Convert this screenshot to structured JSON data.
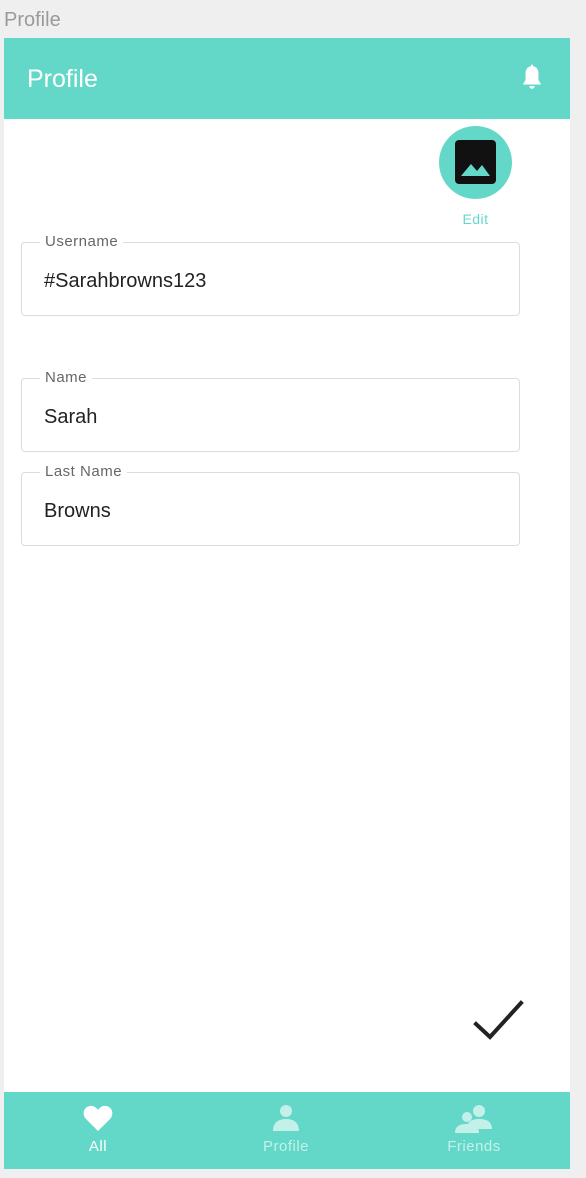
{
  "window": {
    "title": "Profile"
  },
  "app_bar": {
    "title": "Profile",
    "icon": "bell-icon"
  },
  "avatar": {
    "icon": "image-icon",
    "edit_label": "Edit"
  },
  "fields": {
    "username": {
      "label": "Username",
      "value": "#Sarahbrowns123"
    },
    "name": {
      "label": "Name",
      "value": "Sarah"
    },
    "last_name": {
      "label": "Last Name",
      "value": "Browns"
    }
  },
  "confirm": {
    "icon": "check-icon"
  },
  "bottom_nav": {
    "items": [
      {
        "label": "All",
        "icon": "heart-icon",
        "active": true
      },
      {
        "label": "Profile",
        "icon": "person-icon",
        "active": false
      },
      {
        "label": "Friends",
        "icon": "people-icon",
        "active": false
      }
    ]
  },
  "colors": {
    "accent": "#64d8c8",
    "nav_active": "#ffffff",
    "nav_inactive": "#c4f0ea"
  }
}
